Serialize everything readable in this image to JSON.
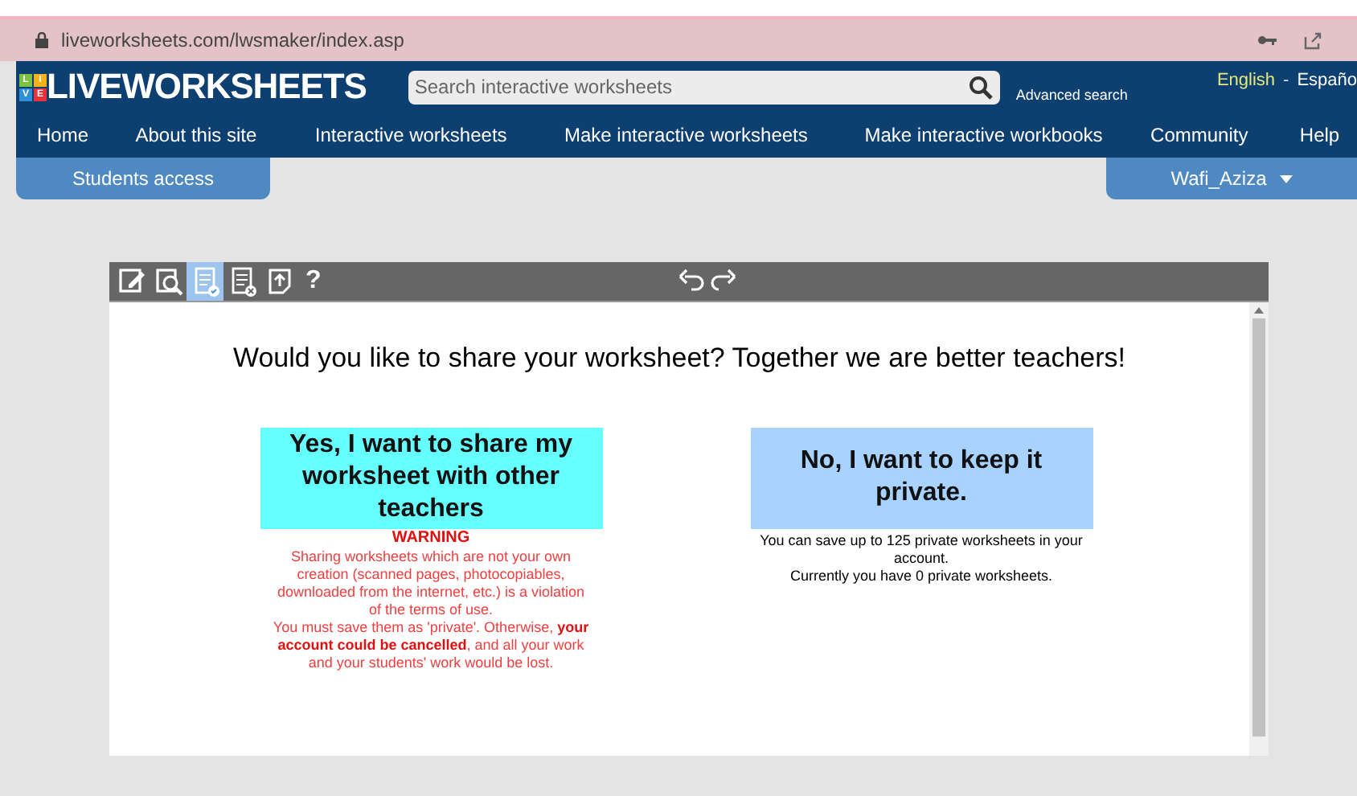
{
  "browser": {
    "url": "liveworksheets.com/lwsmaker/index.asp"
  },
  "header": {
    "logo_tiles": [
      "L",
      "I",
      "V",
      "E"
    ],
    "logo_text": "LIVEWORKSHEETS",
    "search": {
      "placeholder": "Search interactive worksheets"
    },
    "advanced_search": "Advanced search",
    "languages": [
      {
        "label": "English",
        "selected": true
      },
      {
        "label": "Españo",
        "selected": false
      }
    ],
    "language_separator": "-"
  },
  "nav": [
    "Home",
    "About this site",
    "Interactive worksheets",
    "Make interactive worksheets",
    "Make interactive workbooks",
    "Community",
    "Help"
  ],
  "students_access": "Students access",
  "user_menu": "Wafi_Aziza",
  "toolbar": {
    "tools": [
      {
        "kind": "edit",
        "selected": false
      },
      {
        "kind": "preview",
        "selected": false
      },
      {
        "kind": "save",
        "selected": true
      },
      {
        "kind": "discard",
        "selected": false
      },
      {
        "kind": "export",
        "selected": false
      }
    ],
    "help": "?"
  },
  "question": "Would you like to share your worksheet? Together we are better teachers!",
  "share": {
    "button": "Yes, I want to share my worksheet with other teachers",
    "warning_title": "WARNING",
    "warning": "Sharing worksheets which are not your own creation (scanned pages, photocopiables, downloaded from the internet, etc.) is a violation of the terms of use.",
    "warning_2": "You must save them as 'private'. Otherwise, **your account could be cancelled**, and all your work and your students' work would be lost."
  },
  "private": {
    "button": "No, I want to keep it private.",
    "note": "You can save up to 125 private worksheets in your account.",
    "note_2": "Currently you have 0 private worksheets."
  }
}
